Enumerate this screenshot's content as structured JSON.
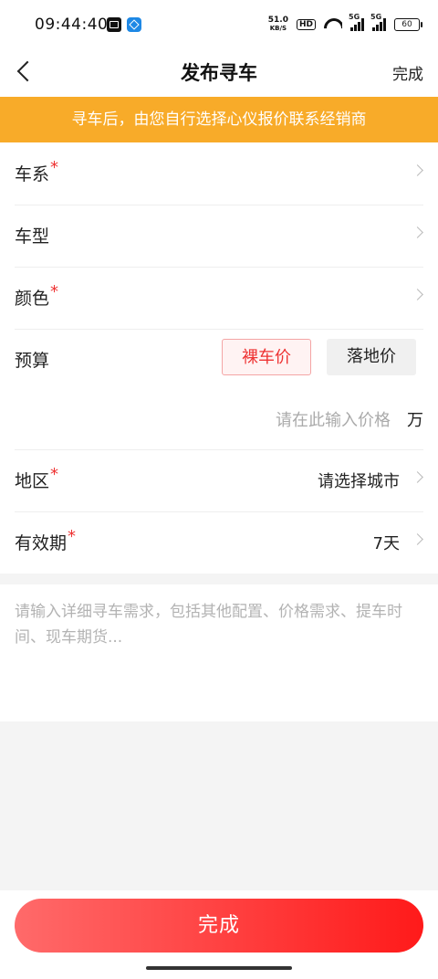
{
  "status_bar": {
    "time": "09:44:40",
    "net_speed_value": "51.0",
    "net_speed_unit": "KB/S",
    "hd_label": "HD",
    "signal_1_tag": "5G",
    "signal_2_tag": "5G",
    "battery": "60"
  },
  "header": {
    "title": "发布寻车",
    "done_label": "完成"
  },
  "notice": {
    "text": "寻车后，由您自行选择心仪报价联系经销商"
  },
  "form": {
    "series": {
      "label": "车系",
      "required_mark": "*"
    },
    "model": {
      "label": "车型"
    },
    "color": {
      "label": "颜色",
      "required_mark": "*"
    },
    "budget": {
      "label": "预算",
      "option_bare": "裸车价",
      "option_landed": "落地价",
      "selected": "裸车价",
      "price_placeholder": "请在此输入价格",
      "unit": "万"
    },
    "region": {
      "label": "地区",
      "required_mark": "*",
      "value": "请选择城市"
    },
    "validity": {
      "label": "有效期",
      "required_mark": "*",
      "value": "7天"
    }
  },
  "description": {
    "placeholder": "请输入详细寻车需求，包括其他配置、价格需求、提车时间、现车期货..."
  },
  "footer": {
    "submit_label": "完成"
  },
  "colors": {
    "notice_bg": "#f8ab29",
    "accent_red": "#e33333",
    "button_gradient_start": "#ff6a6a",
    "button_gradient_end": "#ff1a1a"
  }
}
